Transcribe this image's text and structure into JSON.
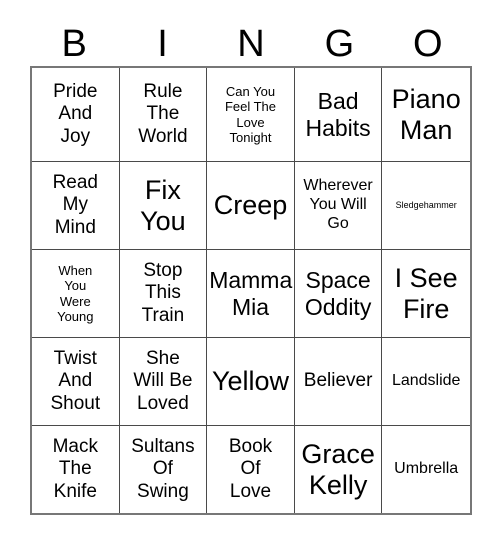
{
  "card": {
    "title": "BINGO",
    "header_letters": [
      "B",
      "I",
      "N",
      "G",
      "O"
    ],
    "columns": 5,
    "rows": 5,
    "colors": {
      "background": "#ffffff",
      "text": "#000000",
      "grid_line": "#4a4a4a",
      "outer_border": "#777777"
    },
    "cells": [
      {
        "text": "Pride\nAnd\nJoy",
        "size": "fs-l"
      },
      {
        "text": "Rule\nThe\nWorld",
        "size": "fs-l"
      },
      {
        "text": "Can You\nFeel The\nLove\nTonight",
        "size": "fs-s"
      },
      {
        "text": "Bad\nHabits",
        "size": "fs-xl"
      },
      {
        "text": "Piano\nMan",
        "size": "fs-xxl"
      },
      {
        "text": "Read\nMy\nMind",
        "size": "fs-l"
      },
      {
        "text": "Fix\nYou",
        "size": "fs-xxl"
      },
      {
        "text": "Creep",
        "size": "fs-xxl"
      },
      {
        "text": "Wherever\nYou Will\nGo",
        "size": "fs-m"
      },
      {
        "text": "Sledgehammer",
        "size": "fs-xs"
      },
      {
        "text": "When\nYou\nWere\nYoung",
        "size": "fs-s"
      },
      {
        "text": "Stop\nThis\nTrain",
        "size": "fs-l"
      },
      {
        "text": "Mamma\nMia",
        "size": "fs-xl"
      },
      {
        "text": "Space\nOddity",
        "size": "fs-xl"
      },
      {
        "text": "I See\nFire",
        "size": "fs-xxl"
      },
      {
        "text": "Twist\nAnd\nShout",
        "size": "fs-l"
      },
      {
        "text": "She\nWill Be\nLoved",
        "size": "fs-l"
      },
      {
        "text": "Yellow",
        "size": "fs-xxl"
      },
      {
        "text": "Believer",
        "size": "fs-l"
      },
      {
        "text": "Landslide",
        "size": "fs-m"
      },
      {
        "text": "Mack\nThe\nKnife",
        "size": "fs-l"
      },
      {
        "text": "Sultans\nOf\nSwing",
        "size": "fs-l"
      },
      {
        "text": "Book\nOf\nLove",
        "size": "fs-l"
      },
      {
        "text": "Grace\nKelly",
        "size": "fs-xxl"
      },
      {
        "text": "Umbrella",
        "size": "fs-m"
      }
    ]
  }
}
